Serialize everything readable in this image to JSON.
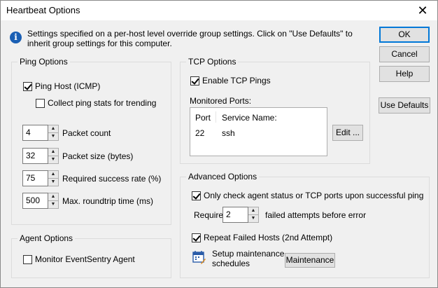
{
  "window": {
    "title": "Heartbeat Options"
  },
  "info": "Settings specified on a per-host level override group settings. Click on \"Use Defaults\" to inherit group settings for this computer.",
  "buttons": {
    "ok": "OK",
    "cancel": "Cancel",
    "help": "Help",
    "use_defaults": "Use Defaults",
    "edit": "Edit ...",
    "maintenance": "Maintenance"
  },
  "ping": {
    "title": "Ping Options",
    "ping_host": {
      "label": "Ping Host (ICMP)",
      "checked": true
    },
    "collect_stats": {
      "label": "Collect ping stats for trending",
      "checked": false
    },
    "packet_count": {
      "value": "4",
      "label": "Packet count"
    },
    "packet_size": {
      "value": "32",
      "label": "Packet size (bytes)"
    },
    "success_rate": {
      "value": "75",
      "label": "Required success rate (%)"
    },
    "roundtrip": {
      "value": "500",
      "label": "Max. roundtrip time (ms)"
    }
  },
  "tcp": {
    "title": "TCP Options",
    "enable": {
      "label": "Enable TCP Pings",
      "checked": true
    },
    "monitored_label": "Monitored Ports:",
    "columns": {
      "port": "Port",
      "service": "Service Name:"
    },
    "rows": [
      {
        "port": "22",
        "service": "ssh"
      }
    ]
  },
  "advanced": {
    "title": "Advanced Options",
    "only_check": {
      "label": "Only check agent status or TCP ports upon successful ping",
      "checked": true
    },
    "require_label": "Require",
    "require_value": "2",
    "failed_label": "failed attempts before error",
    "repeat": {
      "label": "Repeat Failed Hosts (2nd Attempt)",
      "checked": true
    },
    "maintenance_label_1": "Setup maintenance",
    "maintenance_label_2": "schedules"
  },
  "agent": {
    "title": "Agent Options",
    "monitor": {
      "label": "Monitor EventSentry Agent",
      "checked": false
    }
  },
  "icons": {
    "info": "info-icon",
    "close": "close-icon",
    "calendar": "calendar-wrench-icon"
  }
}
